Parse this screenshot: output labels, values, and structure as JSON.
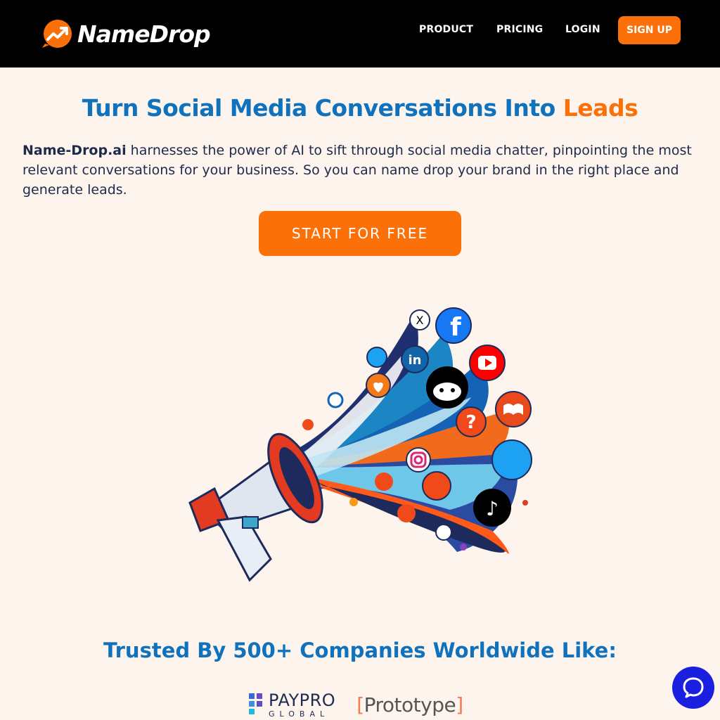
{
  "brand": {
    "name": "NameDrop",
    "accent": "#fb7008",
    "primary": "#1072bd"
  },
  "nav": {
    "product": "PRODUCT",
    "pricing": "PRICING",
    "login": "LOGIN",
    "signup": "SIGN UP"
  },
  "hero": {
    "title_main": "Turn Social Media Conversations Into ",
    "title_accent": "Leads",
    "desc_brand": "Name-Drop.ai",
    "desc_text": " harnesses the power of AI to sift through social media chatter, pinpointing the most relevant conversations for your business. So you can name drop your brand in the right place and generate leads.",
    "cta": "START FOR FREE"
  },
  "trusted": {
    "title": "Trusted By 500+ Companies Worldwide Like:",
    "logos": [
      {
        "name_top": "PAYPRO",
        "name_bottom": "GLOBAL"
      },
      {
        "bracket_open": "[",
        "name": "Prototype",
        "bracket_close": "]"
      }
    ]
  },
  "icons": [
    "x-icon",
    "facebook-icon",
    "twitter-icon",
    "linkedin-icon",
    "youtube-icon",
    "reddit-icon",
    "heart-icon",
    "book-icon",
    "question-icon",
    "instagram-icon",
    "tiktok-icon",
    "chat-icon"
  ]
}
